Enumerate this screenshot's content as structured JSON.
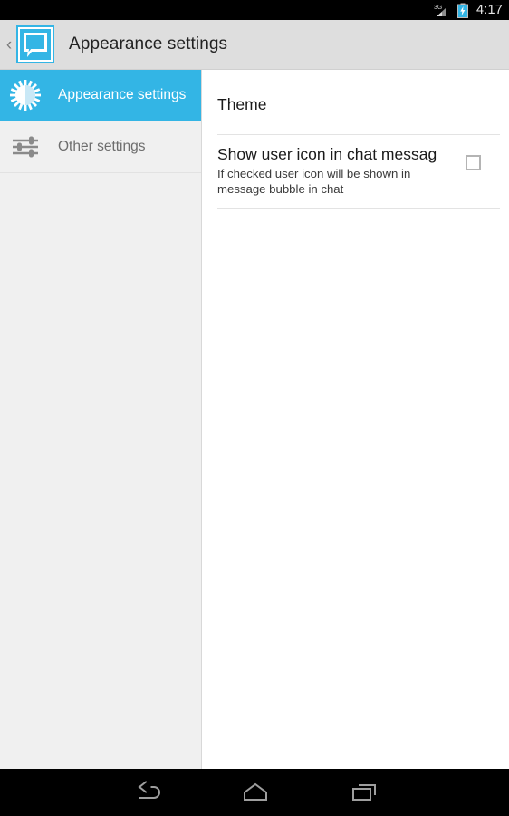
{
  "status_bar": {
    "network_label": "3G",
    "time": "4:17",
    "signal_icon": "signal-3g-icon",
    "battery_icon": "battery-charging-icon",
    "background_color": "#000000",
    "text_color": "#e6e6e6"
  },
  "action_bar": {
    "back_chevron": "‹",
    "app_icon": "chat-bubble-icon",
    "title": "Appearance settings",
    "background_color": "#dedede",
    "accent_color": "#33b5e5"
  },
  "sidebar": {
    "background_color": "#f0f0f0",
    "selected_color": "#33b5e5",
    "items": [
      {
        "label": "Appearance settings",
        "icon": "brightness-contrast-icon",
        "selected": true
      },
      {
        "label": "Other settings",
        "icon": "sliders-icon",
        "selected": false
      }
    ]
  },
  "main": {
    "section_title": "Theme",
    "preferences": [
      {
        "title": "Show user icon in chat messag",
        "summary": "If checked user icon will be shown in message bubble in chat",
        "widget": "checkbox",
        "checked": false
      }
    ]
  },
  "nav_bar": {
    "background_color": "#000000",
    "buttons": [
      {
        "label": "Back",
        "icon": "back-arrow-icon"
      },
      {
        "label": "Home",
        "icon": "home-icon"
      },
      {
        "label": "Recents",
        "icon": "recents-icon"
      }
    ]
  }
}
